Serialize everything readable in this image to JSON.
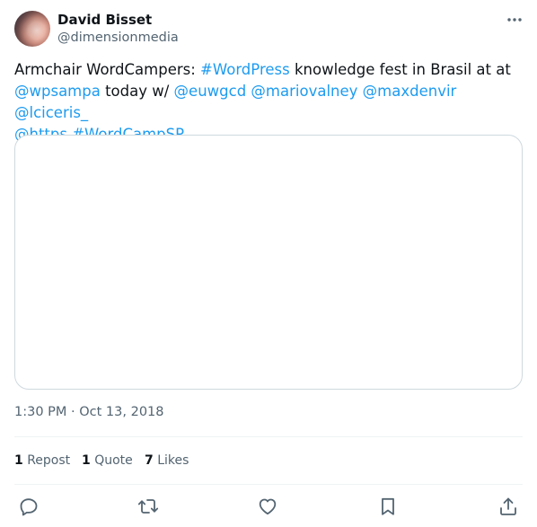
{
  "author": {
    "name": "David Bisset",
    "handle": "@dimensionmedia"
  },
  "tweet": {
    "text_parts": {
      "p1": "Armchair WordCampers: ",
      "p2": "#WordPress",
      "p3": " knowledge fest in Brasil at at",
      "p4": "@wpsampa",
      "p5": " today w/ ",
      "p6": "@euwgcd",
      "p7": "@mariovalney",
      "p8": "@maxdenvir",
      "p9": "@lciceris_",
      "p10": "@https",
      "p11": "#WordCampSP",
      "sp": " "
    },
    "timestamp": "1:30 PM · Oct 13, 2018"
  },
  "stats": {
    "reposts_num": "1",
    "reposts_label": "Repost",
    "quotes_num": "1",
    "quotes_label": "Quote",
    "likes_num": "7",
    "likes_label": "Likes"
  },
  "colors": {
    "link": "#1d9bf0",
    "muted": "#536471",
    "text": "#0f1419",
    "border": "#cfd9de"
  },
  "icons": {
    "more": "more-horizontal-icon",
    "reply": "reply-icon",
    "repost": "repost-icon",
    "like": "heart-icon",
    "bookmark": "bookmark-icon",
    "share": "share-icon"
  }
}
